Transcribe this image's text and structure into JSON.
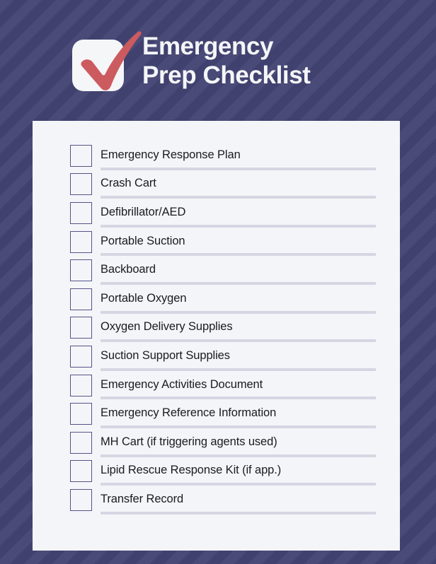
{
  "header": {
    "logo_icon": "checkmark-icon",
    "title_line_1": "Emergency",
    "title_line_2": "Prep Checklist"
  },
  "colors": {
    "background": "#434473",
    "card": "#f4f5f8",
    "accent_red": "#cc5b60",
    "checkbox_border": "#54548a",
    "rule": "#d6d6e3",
    "title_text": "#f4f5f7",
    "item_text": "#1b1b1e"
  },
  "checklist": {
    "items": [
      {
        "label": "Emergency Response Plan",
        "checked": false
      },
      {
        "label": "Crash Cart",
        "checked": false
      },
      {
        "label": "Defibrillator/AED",
        "checked": false
      },
      {
        "label": "Portable Suction",
        "checked": false
      },
      {
        "label": "Backboard",
        "checked": false
      },
      {
        "label": "Portable Oxygen",
        "checked": false
      },
      {
        "label": "Oxygen Delivery Supplies",
        "checked": false
      },
      {
        "label": "Suction Support Supplies",
        "checked": false
      },
      {
        "label": "Emergency Activities Document",
        "checked": false
      },
      {
        "label": "Emergency Reference Information",
        "checked": false
      },
      {
        "label": "MH Cart (if triggering agents used)",
        "checked": false
      },
      {
        "label": "Lipid Rescue Response Kit (if app.)",
        "checked": false
      },
      {
        "label": "Transfer Record",
        "checked": false
      }
    ]
  }
}
